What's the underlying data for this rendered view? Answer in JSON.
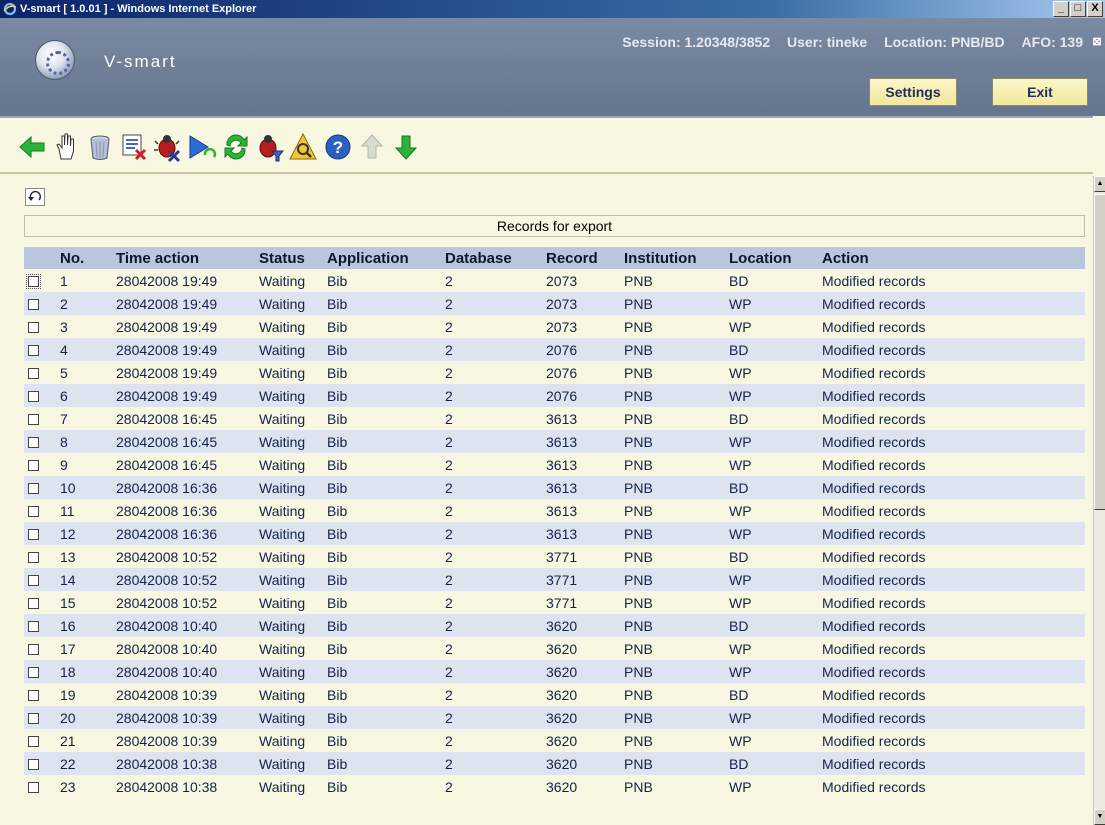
{
  "window": {
    "title": "V-smart [ 1.0.01 ] - Windows Internet Explorer",
    "controls": [
      "_",
      "□",
      "X"
    ]
  },
  "header": {
    "logo_text": "V-smart",
    "session": "Session: 1.20348/3852",
    "user": "User: tineke",
    "location": "Location: PNB/BD",
    "afo": "AFO: 139",
    "close": "⊠",
    "settings_label": "Settings",
    "exit_label": "Exit"
  },
  "toolbar": {
    "icons": [
      "back-arrow-icon",
      "hand-select-icon",
      "trash-icon",
      "delete-list-icon",
      "bug-delete-icon",
      "play-refresh-icon",
      "refresh-icon",
      "bug-filter-icon",
      "search-warning-icon",
      "help-icon",
      "up-arrow-icon",
      "down-arrow-icon"
    ]
  },
  "main": {
    "section_title": "Records for export",
    "columns": [
      "",
      "No.",
      "Time action",
      "Status",
      "Application",
      "Database",
      "Record",
      "Institution",
      "Location",
      "Action"
    ],
    "rows": [
      {
        "no": "1",
        "time": "28042008 19:49",
        "status": "Waiting",
        "app": "Bib",
        "db": "2",
        "record": "2073",
        "inst": "PNB",
        "loc": "BD",
        "action": "Modified records"
      },
      {
        "no": "2",
        "time": "28042008 19:49",
        "status": "Waiting",
        "app": "Bib",
        "db": "2",
        "record": "2073",
        "inst": "PNB",
        "loc": "WP",
        "action": "Modified records"
      },
      {
        "no": "3",
        "time": "28042008 19:49",
        "status": "Waiting",
        "app": "Bib",
        "db": "2",
        "record": "2073",
        "inst": "PNB",
        "loc": "WP",
        "action": "Modified records"
      },
      {
        "no": "4",
        "time": "28042008 19:49",
        "status": "Waiting",
        "app": "Bib",
        "db": "2",
        "record": "2076",
        "inst": "PNB",
        "loc": "BD",
        "action": "Modified records"
      },
      {
        "no": "5",
        "time": "28042008 19:49",
        "status": "Waiting",
        "app": "Bib",
        "db": "2",
        "record": "2076",
        "inst": "PNB",
        "loc": "WP",
        "action": "Modified records"
      },
      {
        "no": "6",
        "time": "28042008 19:49",
        "status": "Waiting",
        "app": "Bib",
        "db": "2",
        "record": "2076",
        "inst": "PNB",
        "loc": "WP",
        "action": "Modified records"
      },
      {
        "no": "7",
        "time": "28042008 16:45",
        "status": "Waiting",
        "app": "Bib",
        "db": "2",
        "record": "3613",
        "inst": "PNB",
        "loc": "BD",
        "action": "Modified records"
      },
      {
        "no": "8",
        "time": "28042008 16:45",
        "status": "Waiting",
        "app": "Bib",
        "db": "2",
        "record": "3613",
        "inst": "PNB",
        "loc": "WP",
        "action": "Modified records"
      },
      {
        "no": "9",
        "time": "28042008 16:45",
        "status": "Waiting",
        "app": "Bib",
        "db": "2",
        "record": "3613",
        "inst": "PNB",
        "loc": "WP",
        "action": "Modified records"
      },
      {
        "no": "10",
        "time": "28042008 16:36",
        "status": "Waiting",
        "app": "Bib",
        "db": "2",
        "record": "3613",
        "inst": "PNB",
        "loc": "BD",
        "action": "Modified records"
      },
      {
        "no": "11",
        "time": "28042008 16:36",
        "status": "Waiting",
        "app": "Bib",
        "db": "2",
        "record": "3613",
        "inst": "PNB",
        "loc": "WP",
        "action": "Modified records"
      },
      {
        "no": "12",
        "time": "28042008 16:36",
        "status": "Waiting",
        "app": "Bib",
        "db": "2",
        "record": "3613",
        "inst": "PNB",
        "loc": "WP",
        "action": "Modified records"
      },
      {
        "no": "13",
        "time": "28042008 10:52",
        "status": "Waiting",
        "app": "Bib",
        "db": "2",
        "record": "3771",
        "inst": "PNB",
        "loc": "BD",
        "action": "Modified records"
      },
      {
        "no": "14",
        "time": "28042008 10:52",
        "status": "Waiting",
        "app": "Bib",
        "db": "2",
        "record": "3771",
        "inst": "PNB",
        "loc": "WP",
        "action": "Modified records"
      },
      {
        "no": "15",
        "time": "28042008 10:52",
        "status": "Waiting",
        "app": "Bib",
        "db": "2",
        "record": "3771",
        "inst": "PNB",
        "loc": "WP",
        "action": "Modified records"
      },
      {
        "no": "16",
        "time": "28042008 10:40",
        "status": "Waiting",
        "app": "Bib",
        "db": "2",
        "record": "3620",
        "inst": "PNB",
        "loc": "BD",
        "action": "Modified records"
      },
      {
        "no": "17",
        "time": "28042008 10:40",
        "status": "Waiting",
        "app": "Bib",
        "db": "2",
        "record": "3620",
        "inst": "PNB",
        "loc": "WP",
        "action": "Modified records"
      },
      {
        "no": "18",
        "time": "28042008 10:40",
        "status": "Waiting",
        "app": "Bib",
        "db": "2",
        "record": "3620",
        "inst": "PNB",
        "loc": "WP",
        "action": "Modified records"
      },
      {
        "no": "19",
        "time": "28042008 10:39",
        "status": "Waiting",
        "app": "Bib",
        "db": "2",
        "record": "3620",
        "inst": "PNB",
        "loc": "BD",
        "action": "Modified records"
      },
      {
        "no": "20",
        "time": "28042008 10:39",
        "status": "Waiting",
        "app": "Bib",
        "db": "2",
        "record": "3620",
        "inst": "PNB",
        "loc": "WP",
        "action": "Modified records"
      },
      {
        "no": "21",
        "time": "28042008 10:39",
        "status": "Waiting",
        "app": "Bib",
        "db": "2",
        "record": "3620",
        "inst": "PNB",
        "loc": "WP",
        "action": "Modified records"
      },
      {
        "no": "22",
        "time": "28042008 10:38",
        "status": "Waiting",
        "app": "Bib",
        "db": "2",
        "record": "3620",
        "inst": "PNB",
        "loc": "BD",
        "action": "Modified records"
      },
      {
        "no": "23",
        "time": "28042008 10:38",
        "status": "Waiting",
        "app": "Bib",
        "db": "2",
        "record": "3620",
        "inst": "PNB",
        "loc": "WP",
        "action": "Modified records"
      }
    ]
  },
  "colors": {
    "header_bg": "#6f7e97",
    "content_bg": "#f7f7e2",
    "row_alt": "#dde4ef",
    "table_header": "#b9c7dc",
    "button_bg": "#f4eaa8"
  }
}
